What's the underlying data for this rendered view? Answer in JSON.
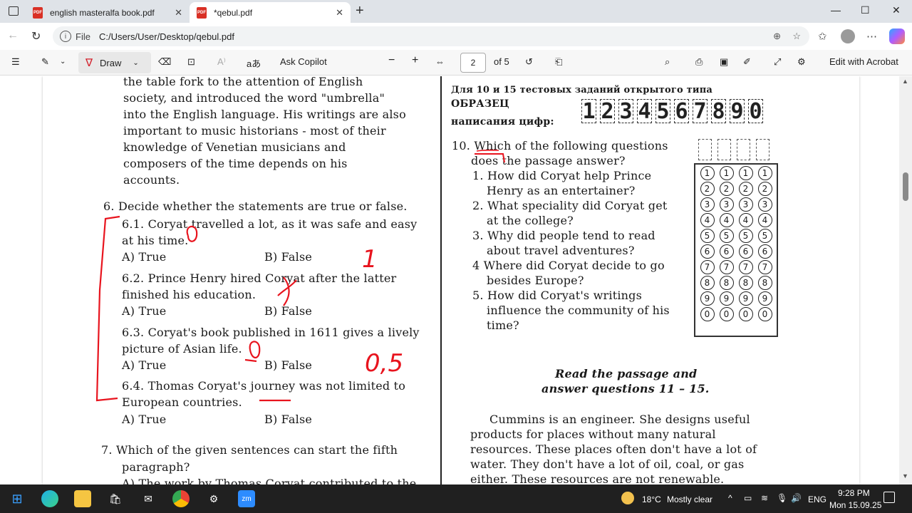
{
  "tabs": [
    {
      "label": "english masteralfa book.pdf",
      "icon": "pdf-icon"
    },
    {
      "label": "*qebul.pdf",
      "icon": "pdf-icon"
    }
  ],
  "window": {
    "minimize": "—",
    "maximize": "☐",
    "close": "✕",
    "new_tab": "+"
  },
  "address": {
    "scheme": "File",
    "url": "C:/Users/User/Desktop/qebul.pdf"
  },
  "pdf_toolbar": {
    "draw_label": "Draw",
    "copilot_label": "Ask Copilot",
    "page_current": "2",
    "page_total": "of 5",
    "edit_label": "Edit with Acrobat"
  },
  "left_column": {
    "lines_top": [
      "the  table  fork  to  the  attention  of  English",
      "society, and introduced the word \"umbrella\"",
      "into the English language. His writings are also",
      "important to music historians - most of their",
      "knowledge    of    Venetian    musicians    and",
      "composers   of   the   time   depends   on   his",
      "accounts."
    ],
    "q6_title": "6. Decide whether the statements are true or false.",
    "q6_items": [
      {
        "line1": "6.1. Coryat travelled a lot, as it was safe and easy",
        "line2": "at his time.",
        "a": "A) True",
        "b": "B) False"
      },
      {
        "line1": "6.2. Prince Henry hired Coryat after the latter",
        "line2": "finished his education.",
        "a": "A) True",
        "b": "B) False"
      },
      {
        "line1": "6.3. Coryat's book published in 1611 gives a lively",
        "line2": "picture of Asian life.",
        "a": "A) True",
        "b": "B) False"
      },
      {
        "line1": "6.4. Thomas Coryat's journey was not limited to",
        "line2": "European countries.",
        "a": "A) True",
        "b": "B) False"
      }
    ],
    "q7_line1": "7. Which of the given sentences can start the fifth",
    "q7_line2": "paragraph?",
    "q7_line3": "A) The work by Thomas Coryat contributed to the"
  },
  "right_column": {
    "header1": "Для 10 и 15 тестовых заданий открытого типа",
    "header2": "ОБРАЗЕЦ",
    "header3": "написания цифр:",
    "sample_digits": [
      "1",
      "2",
      "3",
      "4",
      "5",
      "6",
      "7",
      "8",
      "9",
      "0"
    ],
    "q10_line1": "10. Which of the following questions",
    "q10_line2": "does the passage answer?",
    "q10_options": [
      "1. How did Coryat help Prince",
      "Henry as an entertainer?",
      "2. What speciality did Coryat get",
      "at the college?",
      "3. Why did people tend to read",
      "about travel adventures?",
      "4  Where did Coryat decide to go",
      "besides Europe?",
      "5. How did Coryat's writings",
      "influence the community of his",
      "time?"
    ],
    "omr_digits": [
      "1",
      "2",
      "3",
      "4",
      "5",
      "6",
      "7",
      "8",
      "9",
      "0"
    ],
    "instruction1": "Read the passage and",
    "instruction2": "answer questions 11 – 15.",
    "passage": [
      "Cummins is an engineer. She designs useful",
      "products   for   places   without   many   natural",
      "resources. These places often don't have a lot of",
      "water. They don't have a lot of oil, coal, or gas",
      "either. These resources are not renewable."
    ]
  },
  "handwriting": {
    "score": "0,5",
    "mark": "1"
  },
  "taskbar": {
    "weather_temp": "18°C",
    "weather_text": "Mostly clear",
    "lang": "ENG",
    "time": "9:28 PM",
    "date": "Mon 15.09.25"
  },
  "colors": {
    "ink": "#e8141e",
    "tabbar": "#dfe3e8",
    "taskbar": "#202020"
  }
}
